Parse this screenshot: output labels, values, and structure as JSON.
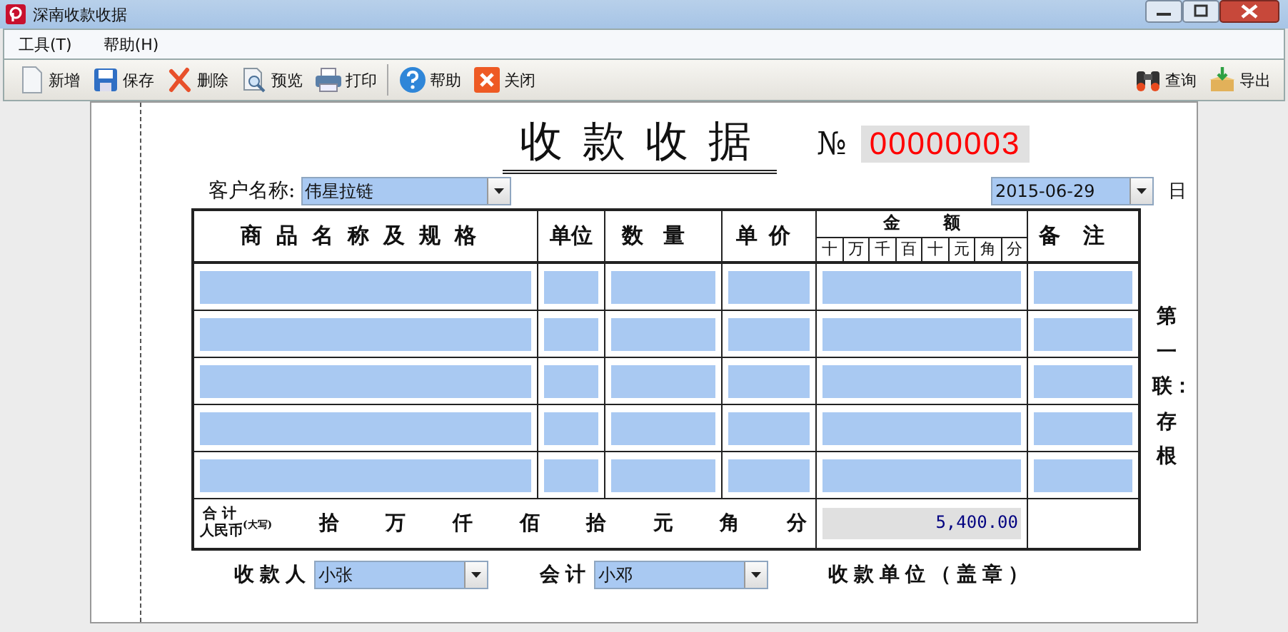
{
  "window": {
    "title": "深南收款收据"
  },
  "menu": [
    "工具(T)",
    "帮助(H)"
  ],
  "toolbar_left": [
    {
      "kind": "new",
      "label": "新增"
    },
    {
      "kind": "save",
      "label": "保存"
    },
    {
      "kind": "delete",
      "label": "删除"
    },
    {
      "kind": "preview",
      "label": "预览"
    },
    {
      "kind": "print",
      "label": "打印"
    },
    {
      "kind": "help",
      "label": "帮助"
    },
    {
      "kind": "close",
      "label": "关闭"
    }
  ],
  "toolbar_right": [
    {
      "kind": "search",
      "label": "查询"
    },
    {
      "kind": "export",
      "label": "导出"
    }
  ],
  "receipt": {
    "title": "收款收据",
    "number_sign": "№",
    "number": "00000003",
    "customer_label": "客户名称:",
    "customer": "伟星拉链",
    "date": "2015-06-29",
    "date_suffix": "日",
    "columns": [
      "商品名称及规格",
      "单位",
      "数量",
      "单价",
      "金额",
      "备注"
    ],
    "amount_digits": [
      "十",
      "万",
      "千",
      "百",
      "十",
      "元",
      "角",
      "分"
    ],
    "rows": [
      {
        "kind": "blank"
      },
      {
        "kind": "blank"
      },
      {
        "kind": "blank"
      },
      {
        "kind": "blank"
      },
      {
        "kind": "blank"
      }
    ],
    "total_label": "合 计",
    "total_currency": "人民币",
    "total_note": "(大写)",
    "total_units": [
      "拾",
      "万",
      "仟",
      "佰",
      "拾",
      "元",
      "角",
      "分"
    ],
    "total_amount": "5,400.00",
    "copy_note": "第一联：存根",
    "payee_label": "收款人",
    "payee": "小张",
    "accountant_label": "会计",
    "accountant": "小邓",
    "unit_label": "收款单位（盖章）"
  }
}
